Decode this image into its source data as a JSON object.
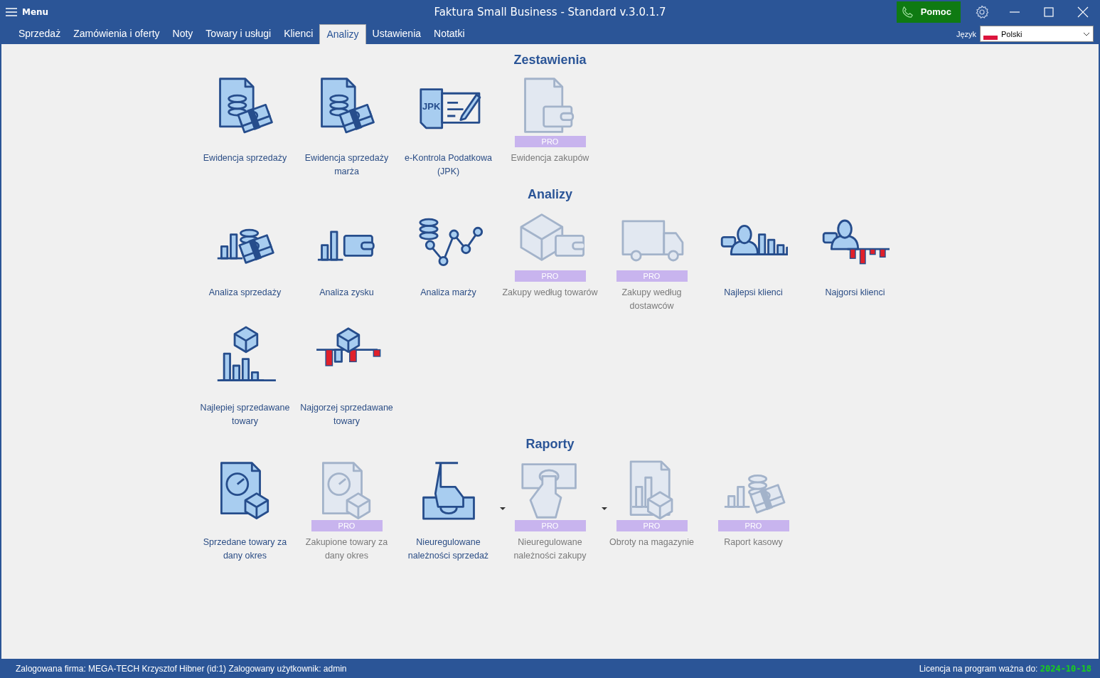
{
  "window": {
    "menu_label": "Menu",
    "title": "Faktura Small Business - Standard v.3.0.1.7",
    "help_button": "Pomoc"
  },
  "tabs": [
    {
      "label": "Sprzedaż",
      "selected": false
    },
    {
      "label": "Zamówienia i oferty",
      "selected": false
    },
    {
      "label": "Noty",
      "selected": false
    },
    {
      "label": "Towary i usługi",
      "selected": false
    },
    {
      "label": "Klienci",
      "selected": false
    },
    {
      "label": "Analizy",
      "selected": true
    },
    {
      "label": "Ustawienia",
      "selected": false
    },
    {
      "label": "Notatki",
      "selected": false
    }
  ],
  "language": {
    "label": "Język",
    "value": "Polski"
  },
  "sections": [
    {
      "title": "Zestawienia",
      "tiles": [
        {
          "label": "Ewidencja sprzedaży",
          "pro": false
        },
        {
          "label": "Ewidencja sprzedaży marża",
          "pro": false
        },
        {
          "label": "e-Kontrola Podatkowa (JPK)",
          "pro": false,
          "icon_text": "JPK"
        },
        {
          "label": "Ewidencja zakupów",
          "pro": true,
          "badge": "PRO"
        }
      ]
    },
    {
      "title": "Analizy",
      "tiles": [
        {
          "label": "Analiza sprzedaży",
          "pro": false
        },
        {
          "label": "Analiza zysku",
          "pro": false
        },
        {
          "label": "Analiza marży",
          "pro": false
        },
        {
          "label": "Zakupy według towarów",
          "pro": true,
          "badge": "PRO"
        },
        {
          "label": "Zakupy według dostawców",
          "pro": true,
          "badge": "PRO"
        },
        {
          "label": "Najlepsi klienci",
          "pro": false
        },
        {
          "label": "Najgorsi klienci",
          "pro": false
        },
        {
          "label": "Najlepiej sprzedawane towary",
          "pro": false
        },
        {
          "label": "Najgorzej sprzedawane towary",
          "pro": false
        }
      ]
    },
    {
      "title": "Raporty",
      "tiles": [
        {
          "label": "Sprzedane towary za dany okres",
          "pro": false
        },
        {
          "label": "Zakupione towary za dany okres",
          "pro": true,
          "badge": "PRO"
        },
        {
          "label": "Nieuregulowane należności sprzedaż",
          "pro": false,
          "has_menu": true
        },
        {
          "label": "Nieuregulowane należności zakupy",
          "pro": true,
          "badge": "PRO",
          "has_menu": true
        },
        {
          "label": "Obroty na magazynie",
          "pro": true,
          "badge": "PRO"
        },
        {
          "label": "Raport kasowy",
          "pro": true,
          "badge": "PRO"
        }
      ]
    }
  ],
  "status_bar": {
    "left": "Zalogowana firma: MEGA-TECH Krzysztof Hibner (id:1) Zalogowany użytkownik: admin",
    "license_label": "Licencja na program ważna do:",
    "license_date": "2024-10-18"
  }
}
